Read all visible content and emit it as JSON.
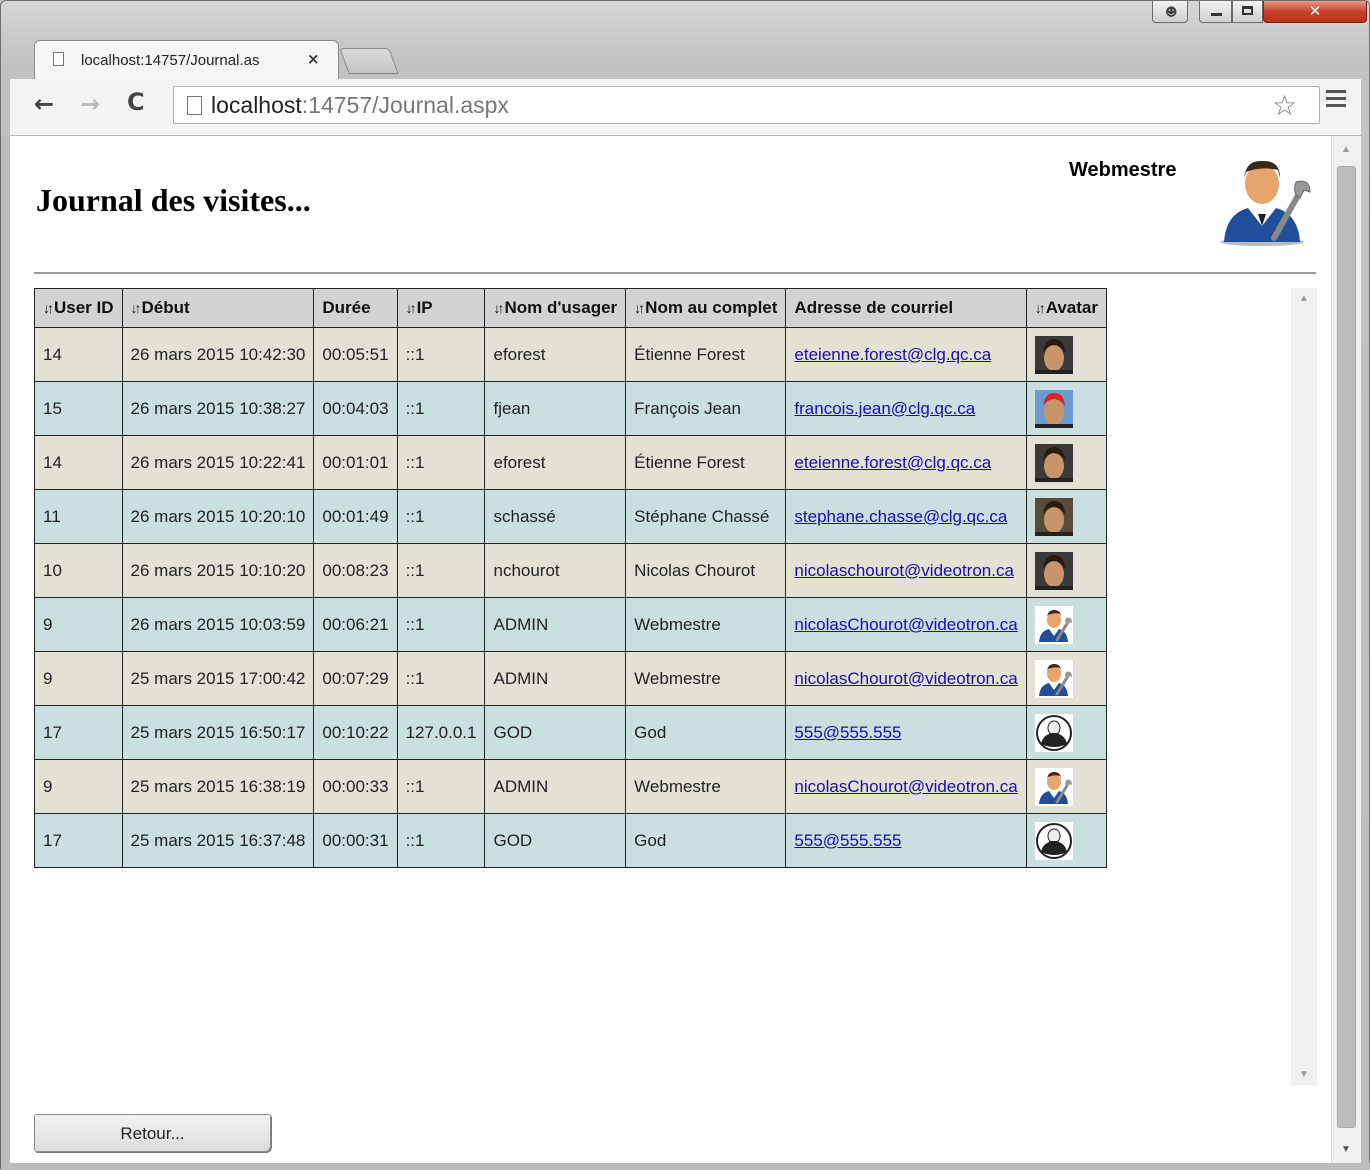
{
  "browser": {
    "tab_title": "localhost:14757/Journal.as",
    "url_host": "localhost",
    "url_path": ":14757/Journal.aspx"
  },
  "page": {
    "title": "Journal des visites...",
    "user_name": "Webmestre",
    "back_button": "Retour..."
  },
  "icons": {
    "sort": "↓↑",
    "back": "←",
    "forward": "→",
    "reload": "C",
    "star": "☆",
    "close": "×"
  },
  "table": {
    "headers": [
      {
        "label": "User ID",
        "sortable": true
      },
      {
        "label": "Début",
        "sortable": true
      },
      {
        "label": "Durée",
        "sortable": false
      },
      {
        "label": "IP",
        "sortable": true
      },
      {
        "label": "Nom d'usager",
        "sortable": true
      },
      {
        "label": "Nom au complet",
        "sortable": true
      },
      {
        "label": "Adresse de courriel",
        "sortable": false
      },
      {
        "label": "Avatar",
        "sortable": true
      }
    ],
    "rows": [
      {
        "user_id": "14",
        "debut": "26 mars 2015 10:42:30",
        "duree": "00:05:51",
        "ip": "::1",
        "username": "eforest",
        "fullname": "Étienne Forest",
        "email": "eteienne.forest@clg.qc.ca",
        "avatar": "photo-dark"
      },
      {
        "user_id": "15",
        "debut": "26 mars 2015 10:38:27",
        "duree": "00:04:03",
        "ip": "::1",
        "username": "fjean",
        "fullname": "François Jean",
        "email": "francois.jean@clg.qc.ca",
        "avatar": "photo-red-cap"
      },
      {
        "user_id": "14",
        "debut": "26 mars 2015 10:22:41",
        "duree": "00:01:01",
        "ip": "::1",
        "username": "eforest",
        "fullname": "Étienne Forest",
        "email": "eteienne.forest@clg.qc.ca",
        "avatar": "photo-dark"
      },
      {
        "user_id": "11",
        "debut": "26 mars 2015 10:20:10",
        "duree": "00:01:49",
        "ip": "::1",
        "username": "schassé",
        "fullname": "Stéphane Chassé",
        "email": "stephane.chasse@clg.qc.ca",
        "avatar": "photo-brown"
      },
      {
        "user_id": "10",
        "debut": "26 mars 2015 10:10:20",
        "duree": "00:08:23",
        "ip": "::1",
        "username": "nchourot",
        "fullname": "Nicolas Chourot",
        "email": "nicolaschourot@videotron.ca",
        "avatar": "photo-dark"
      },
      {
        "user_id": "9",
        "debut": "26 mars 2015 10:03:59",
        "duree": "00:06:21",
        "ip": "::1",
        "username": "ADMIN",
        "fullname": "Webmestre",
        "email": "nicolasChourot@videotron.ca",
        "avatar": "webmaster"
      },
      {
        "user_id": "9",
        "debut": "25 mars 2015 17:00:42",
        "duree": "00:07:29",
        "ip": "::1",
        "username": "ADMIN",
        "fullname": "Webmestre",
        "email": "nicolasChourot@videotron.ca",
        "avatar": "webmaster"
      },
      {
        "user_id": "17",
        "debut": "25 mars 2015 16:50:17",
        "duree": "00:10:22",
        "ip": "127.0.0.1",
        "username": "GOD",
        "fullname": "God",
        "email": "555@555.555",
        "avatar": "anonymous"
      },
      {
        "user_id": "9",
        "debut": "25 mars 2015 16:38:19",
        "duree": "00:00:33",
        "ip": "::1",
        "username": "ADMIN",
        "fullname": "Webmestre",
        "email": "nicolasChourot@videotron.ca",
        "avatar": "webmaster"
      },
      {
        "user_id": "17",
        "debut": "25 mars 2015 16:37:48",
        "duree": "00:00:31",
        "ip": "::1",
        "username": "GOD",
        "fullname": "God",
        "email": "555@555.555",
        "avatar": "anonymous"
      }
    ]
  },
  "colors": {
    "row_odd": "#e2e1d4",
    "row_even": "#c9dfe0",
    "header_bg": "#d3d3d3",
    "link": "#1a0dab",
    "close_button": "#c7412a"
  }
}
